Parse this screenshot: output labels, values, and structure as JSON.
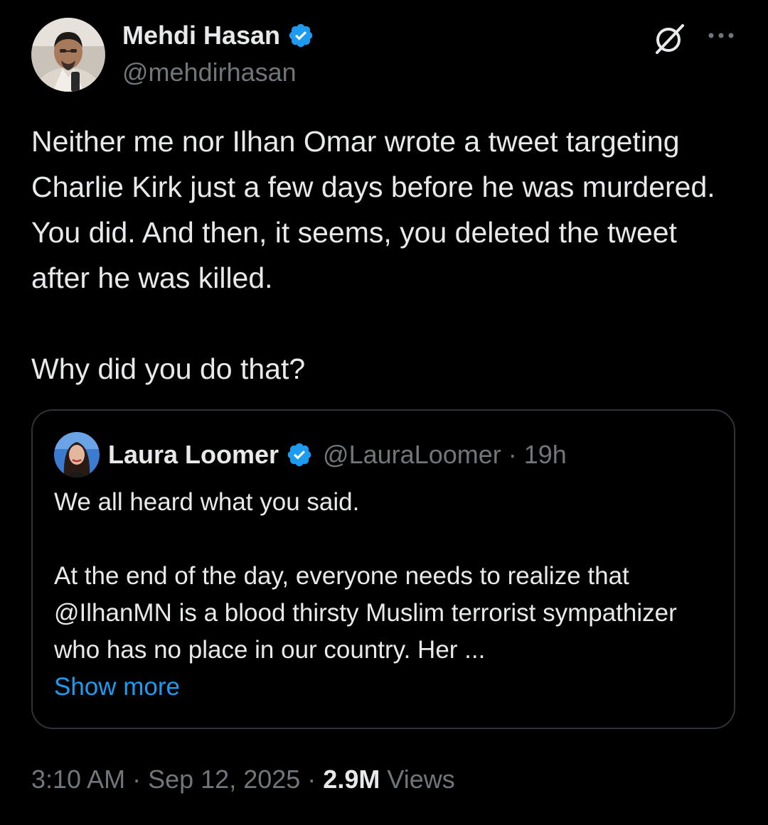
{
  "author": {
    "name": "Mehdi Hasan",
    "handle": "@mehdirhasan"
  },
  "tweet": {
    "paragraphs": [
      "Neither me nor Ilhan Omar wrote a tweet targeting Charlie Kirk just a few days before he was murdered. You did. And then, it seems, you deleted the tweet after he was killed.",
      "Why did you do that?"
    ]
  },
  "quoted_tweet": {
    "name": "Laura Loomer",
    "handle": "@LauraLoomer",
    "separator": "·",
    "time": "19h",
    "paragraphs": [
      "We all heard what you said.",
      "At the end of the day, everyone needs to realize that @IlhanMN is a blood thirsty Muslim terrorist sympathizer who has no place in our country. Her ..."
    ],
    "show_more_label": "Show more"
  },
  "meta": {
    "time": "3:10 AM",
    "sep1": " · ",
    "date": "Sep 12, 2025",
    "sep2": " · ",
    "views_count": "2.9M",
    "views_label": " Views"
  },
  "icons": {
    "verified": "verified-badge-icon",
    "grok": "grok-icon",
    "more": "more-icon"
  },
  "colors": {
    "background": "#000000",
    "text": "#e7e9ea",
    "secondary": "#71767b",
    "accent": "#1d9bf0",
    "border": "#2f3336"
  }
}
